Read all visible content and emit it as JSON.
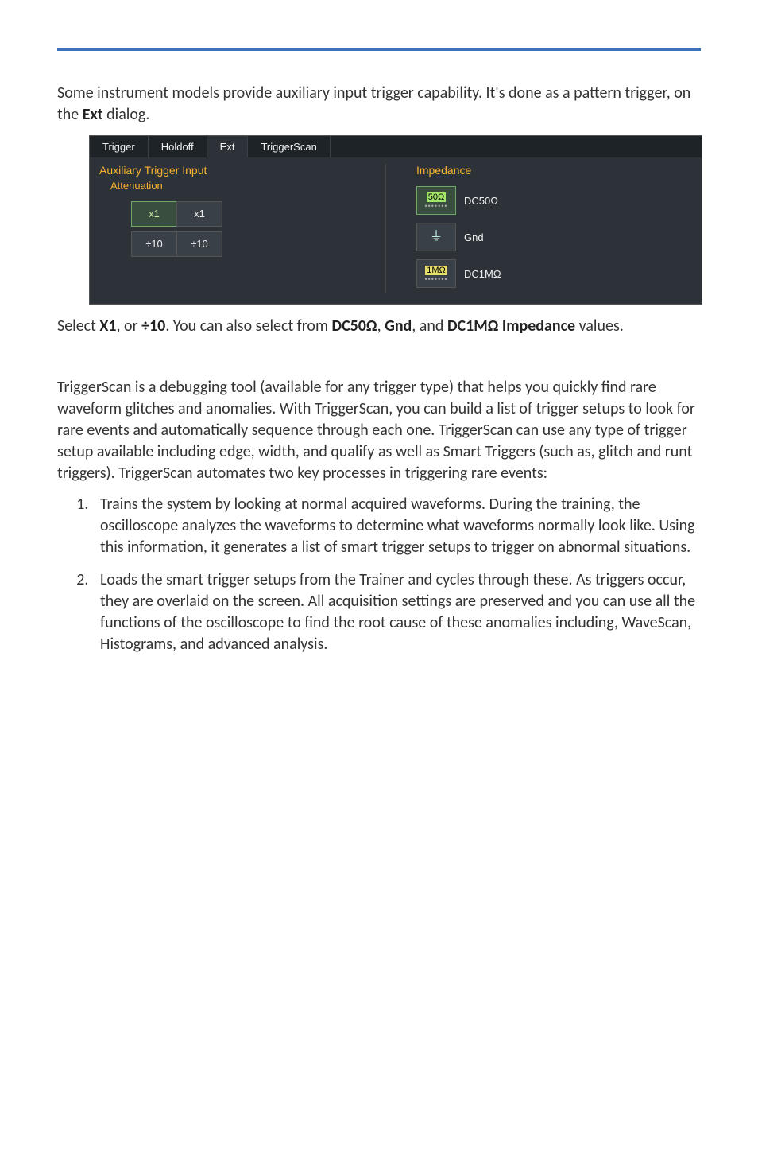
{
  "intro_pre": "Some instrument models provide auxiliary input trigger capability. It's done as a pattern trigger, on the ",
  "intro_bold": "Ext",
  "intro_post": " dialog.",
  "figure": {
    "tabs": {
      "trigger": "Trigger",
      "holdoff": "Holdoff",
      "ext": "Ext",
      "triggerscan": "TriggerScan"
    },
    "left": {
      "title": "Auxiliary Trigger Input",
      "sub": "Attenuation",
      "x1": "x1",
      "x1b": "x1",
      "d10": "÷10",
      "d10b": "÷10"
    },
    "right": {
      "title": "Impedance",
      "r1": {
        "box": "50Ω",
        "label": "DC50Ω"
      },
      "r2": {
        "label": "Gnd"
      },
      "r3": {
        "box": "1MΩ",
        "label": "DC1MΩ"
      }
    }
  },
  "caption": {
    "pre": "Select ",
    "b1": "X1",
    "mid1": ", or ",
    "b2": "÷10",
    "mid2": ". You can also select from ",
    "b3": "DC50Ω",
    "c1": ", ",
    "b4": "Gnd",
    "c2": ", and ",
    "b5": "DC1MΩ Impedance",
    "post": " values."
  },
  "ts_intro": "TriggerScan is a debugging tool (available for any trigger type) that helps you quickly find rare waveform glitches and anomalies. With TriggerScan, you can build a list of trigger setups to look for rare events and automatically sequence through each one. TriggerScan can use any type of trigger setup available including edge, width, and qualify as well as Smart Triggers (such as, glitch and runt triggers). TriggerScan automates two key processes in triggering rare events:",
  "list": {
    "i1": "Trains the system by looking at normal acquired waveforms. During the training, the oscilloscope analyzes the waveforms to determine what waveforms normally look like. Using this information, it generates a list of smart trigger setups to trigger on abnormal situations.",
    "i2": "Loads the smart trigger setups from the Trainer and cycles through these. As triggers occur, they are overlaid on the screen. All acquisition settings are preserved and you can use all the functions of the oscilloscope to find the root cause of these anomalies including, WaveScan, Histograms, and advanced analysis."
  }
}
